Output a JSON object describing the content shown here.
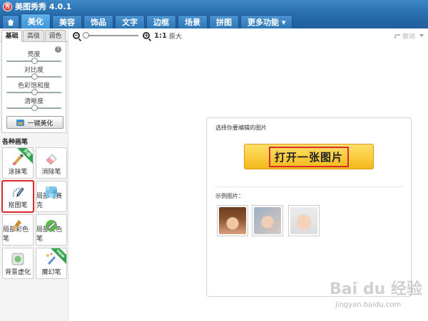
{
  "app": {
    "title": "美图秀秀 4.0.1",
    "logo_text": "秀"
  },
  "tabs": [
    {
      "label": "美化",
      "active": true
    },
    {
      "label": "美容"
    },
    {
      "label": "饰品"
    },
    {
      "label": "文字"
    },
    {
      "label": "边框"
    },
    {
      "label": "场景"
    },
    {
      "label": "拼图"
    },
    {
      "label": "更多功能 ▾"
    }
  ],
  "sidebar": {
    "subtabs": [
      "基础",
      "高级",
      "调色"
    ],
    "sliders": [
      {
        "label": "亮度",
        "value": 0.5
      },
      {
        "label": "对比度",
        "value": 0.5
      },
      {
        "label": "色彩饱和度",
        "value": 0.5
      },
      {
        "label": "清晰度",
        "value": 0.5
      }
    ],
    "auto_button": "一键美化",
    "brushes_title": "各种画笔",
    "tools": [
      {
        "label": "涂抹笔",
        "badge": "升级",
        "icon": "smudge-brush-icon"
      },
      {
        "label": "消除笔",
        "icon": "eraser-icon"
      },
      {
        "label": "抠图笔",
        "icon": "cutout-pen-icon",
        "selected": true
      },
      {
        "label": "局部马赛克",
        "icon": "mosaic-icon"
      },
      {
        "label": "局部彩色笔",
        "icon": "color-brush-icon"
      },
      {
        "label": "局部变色笔",
        "icon": "recolor-brush-icon"
      },
      {
        "label": "背景虚化",
        "icon": "background-blur-icon"
      },
      {
        "label": "魔幻笔",
        "badge": "new",
        "icon": "magic-pen-icon"
      }
    ]
  },
  "toolbar": {
    "ratio": "1:1",
    "original": "原大",
    "undo": "撤销",
    "zoom_level": 0.0
  },
  "panel": {
    "title": "选择你要编辑的图片",
    "open_button": "打开一张图片",
    "examples_label": "示例图片："
  },
  "watermark": {
    "text": "Bai du 经验",
    "url": "jingyan.baidu.com"
  }
}
